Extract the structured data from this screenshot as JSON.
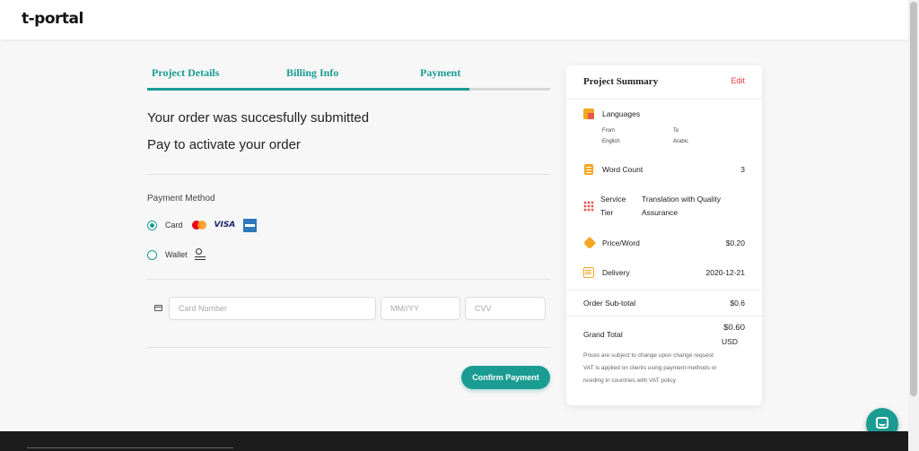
{
  "app": {
    "logo": "t-portal"
  },
  "steps": {
    "items": [
      "Project Details",
      "Billing Info",
      "Payment"
    ],
    "progress": 0.8
  },
  "order": {
    "message": "Your order was succesfully submitted",
    "submessage": "Pay to activate your order"
  },
  "payment": {
    "label": "Payment Method",
    "options": [
      {
        "label": "Card",
        "selected": true
      },
      {
        "label": "Wallet",
        "selected": false
      }
    ],
    "card_brands": {
      "visa": "VISA"
    },
    "card_number_placeholder": "Card Number",
    "expiry_placeholder": "MM//YY",
    "cvv_placeholder": "CVV",
    "confirm_label": "Confirm Payment"
  },
  "summary": {
    "title": "Project Summary",
    "edit": "Edit",
    "languages": {
      "label": "Languages",
      "from_label": "From",
      "to_label": "To",
      "from": "English",
      "to": "Arabic"
    },
    "word_count": {
      "label": "Word Count",
      "value": "3"
    },
    "service_tier": {
      "label_1": "Service",
      "label_2": "Tier",
      "value_1": "Translation with Quality",
      "value_2": "Assurance"
    },
    "price_word": {
      "label": "Price/Word",
      "value": "$0.20"
    },
    "delivery": {
      "label": "Delivery",
      "value": "2020-12-21"
    },
    "subtotal": {
      "label": "Order Sub-total",
      "value": "$0.6"
    },
    "grand_total": {
      "label": "Grand Total",
      "value": "$0.60",
      "currency": "USD"
    },
    "notes": [
      "Prices are subject to change upon change request",
      "VAT is applied on clients using payment methods or",
      "residing in countries with VAT policy"
    ]
  },
  "colors": {
    "accent": "#1a9c93",
    "edit": "#e53b3b",
    "icon_orange": "#f5a623"
  }
}
